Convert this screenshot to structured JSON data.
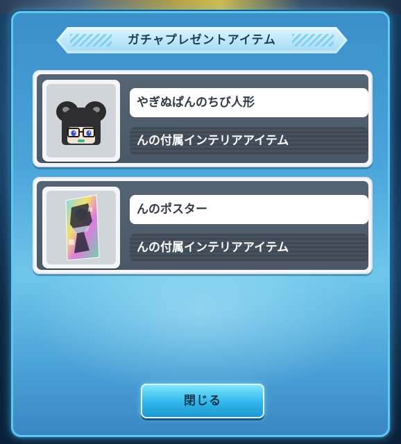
{
  "dialog": {
    "title": "ガチャプレゼントアイテム",
    "close_label": "閉じる"
  },
  "items": [
    {
      "name": "やぎぬぱんのちび人形",
      "description": "んの付属インテリアアイテム",
      "icon": "chibi-doll-icon"
    },
    {
      "name": "んのポスター",
      "description": "んの付属インテリアアイテム",
      "icon": "poster-icon"
    }
  ],
  "colors": {
    "modal_border": "#5fc8f0",
    "modal_bg": "#4aa3d9",
    "card_dark": "#4a5867",
    "button_accent": "#2fb6ea"
  }
}
